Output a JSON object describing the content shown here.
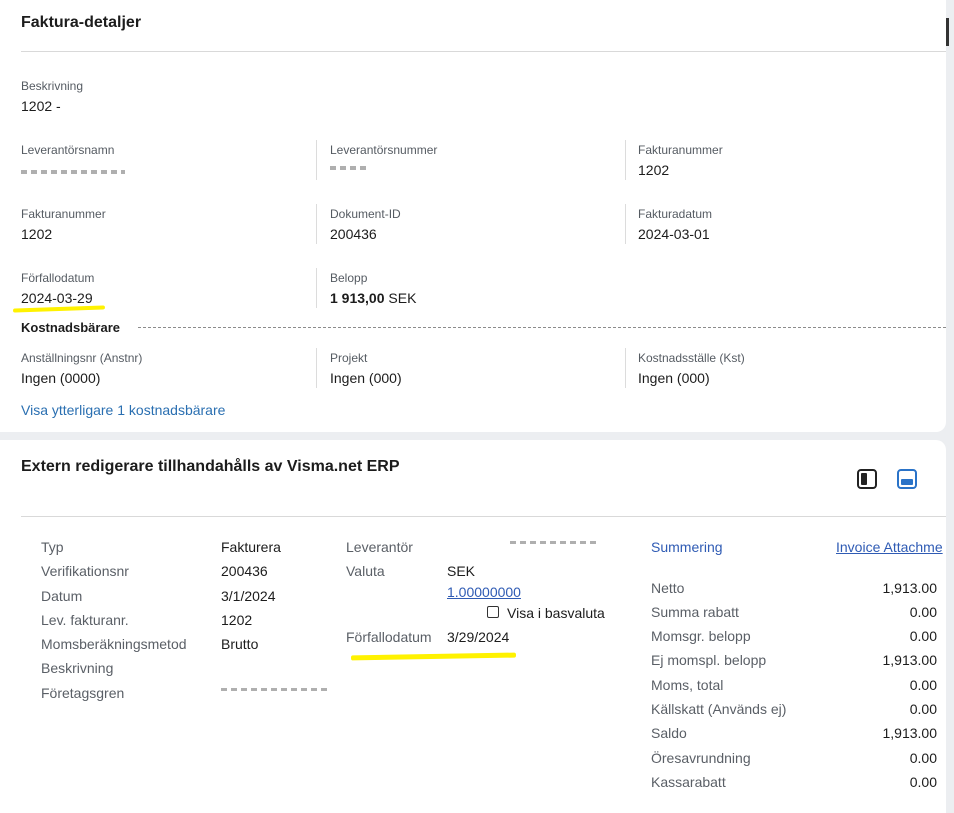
{
  "invoice_details": {
    "title": "Faktura-detaljer",
    "beskrivning": {
      "label": "Beskrivning",
      "value": "1202 -"
    },
    "row1": [
      {
        "label": "Leverantörsnamn",
        "value": ""
      },
      {
        "label": "Leverantörsnummer",
        "value": ""
      },
      {
        "label": "Fakturanummer",
        "value": "1202"
      }
    ],
    "row2": [
      {
        "label": "Fakturanummer",
        "value": "1202"
      },
      {
        "label": "Dokument-ID",
        "value": "200436"
      },
      {
        "label": "Fakturadatum",
        "value": "2024-03-01"
      }
    ],
    "row3": [
      {
        "label": "Förfallodatum",
        "value": "2024-03-29"
      },
      {
        "label": "Belopp",
        "value": "1 913,00",
        "unit": "SEK"
      }
    ],
    "cost_section_title": "Kostnadsbärare",
    "cost_row": [
      {
        "label": "Anställningsnr (Anstnr)",
        "value": "Ingen (0000)"
      },
      {
        "label": "Projekt",
        "value": "Ingen (000)"
      },
      {
        "label": "Kostnadsställe (Kst)",
        "value": "Ingen (000)"
      }
    ],
    "more_link": "Visa ytterligare 1 kostnadsbärare"
  },
  "external_editor": {
    "title": "Extern redigerare tillhandahålls av Visma.net ERP",
    "left_fields": [
      {
        "label": "Typ",
        "value": "Fakturera"
      },
      {
        "label": "Verifikationsnr",
        "value": "200436"
      },
      {
        "label": "Datum",
        "value": "3/1/2024"
      },
      {
        "label": "Lev. fakturanr.",
        "value": "1202"
      },
      {
        "label": "Momsberäkningsmetod",
        "value": "Brutto"
      },
      {
        "label": "Beskrivning",
        "value": ""
      },
      {
        "label": "Företagsgren",
        "value": ""
      }
    ],
    "mid": {
      "leverantor_label": "Leverantör",
      "valuta_label": "Valuta",
      "valuta_value": "SEK",
      "rate_link": "1.00000000",
      "base_currency_label": "Visa i basvaluta",
      "forfallodatum_label": "Förfallodatum",
      "forfallodatum_value": "3/29/2024"
    },
    "right": {
      "tab_summary": "Summering",
      "tab_attachments": "Invoice Attachme",
      "rows": [
        {
          "label": "Netto",
          "value": "1,913.00"
        },
        {
          "label": "Summa rabatt",
          "value": "0.00"
        },
        {
          "label": "Momsgr. belopp",
          "value": "0.00"
        },
        {
          "label": "Ej momspl. belopp",
          "value": "1,913.00"
        },
        {
          "label": "Moms, total",
          "value": "0.00"
        },
        {
          "label": "Källskatt (Används ej)",
          "value": "0.00"
        },
        {
          "label": "Saldo",
          "value": "1,913.00"
        },
        {
          "label": "Öresavrundning",
          "value": "0.00"
        },
        {
          "label": "Kassarabatt",
          "value": "0.00"
        }
      ]
    }
  },
  "colors": {
    "link": "#2a6fb1",
    "highlight": "#fff200",
    "accent_blue": "#2a73c8"
  }
}
